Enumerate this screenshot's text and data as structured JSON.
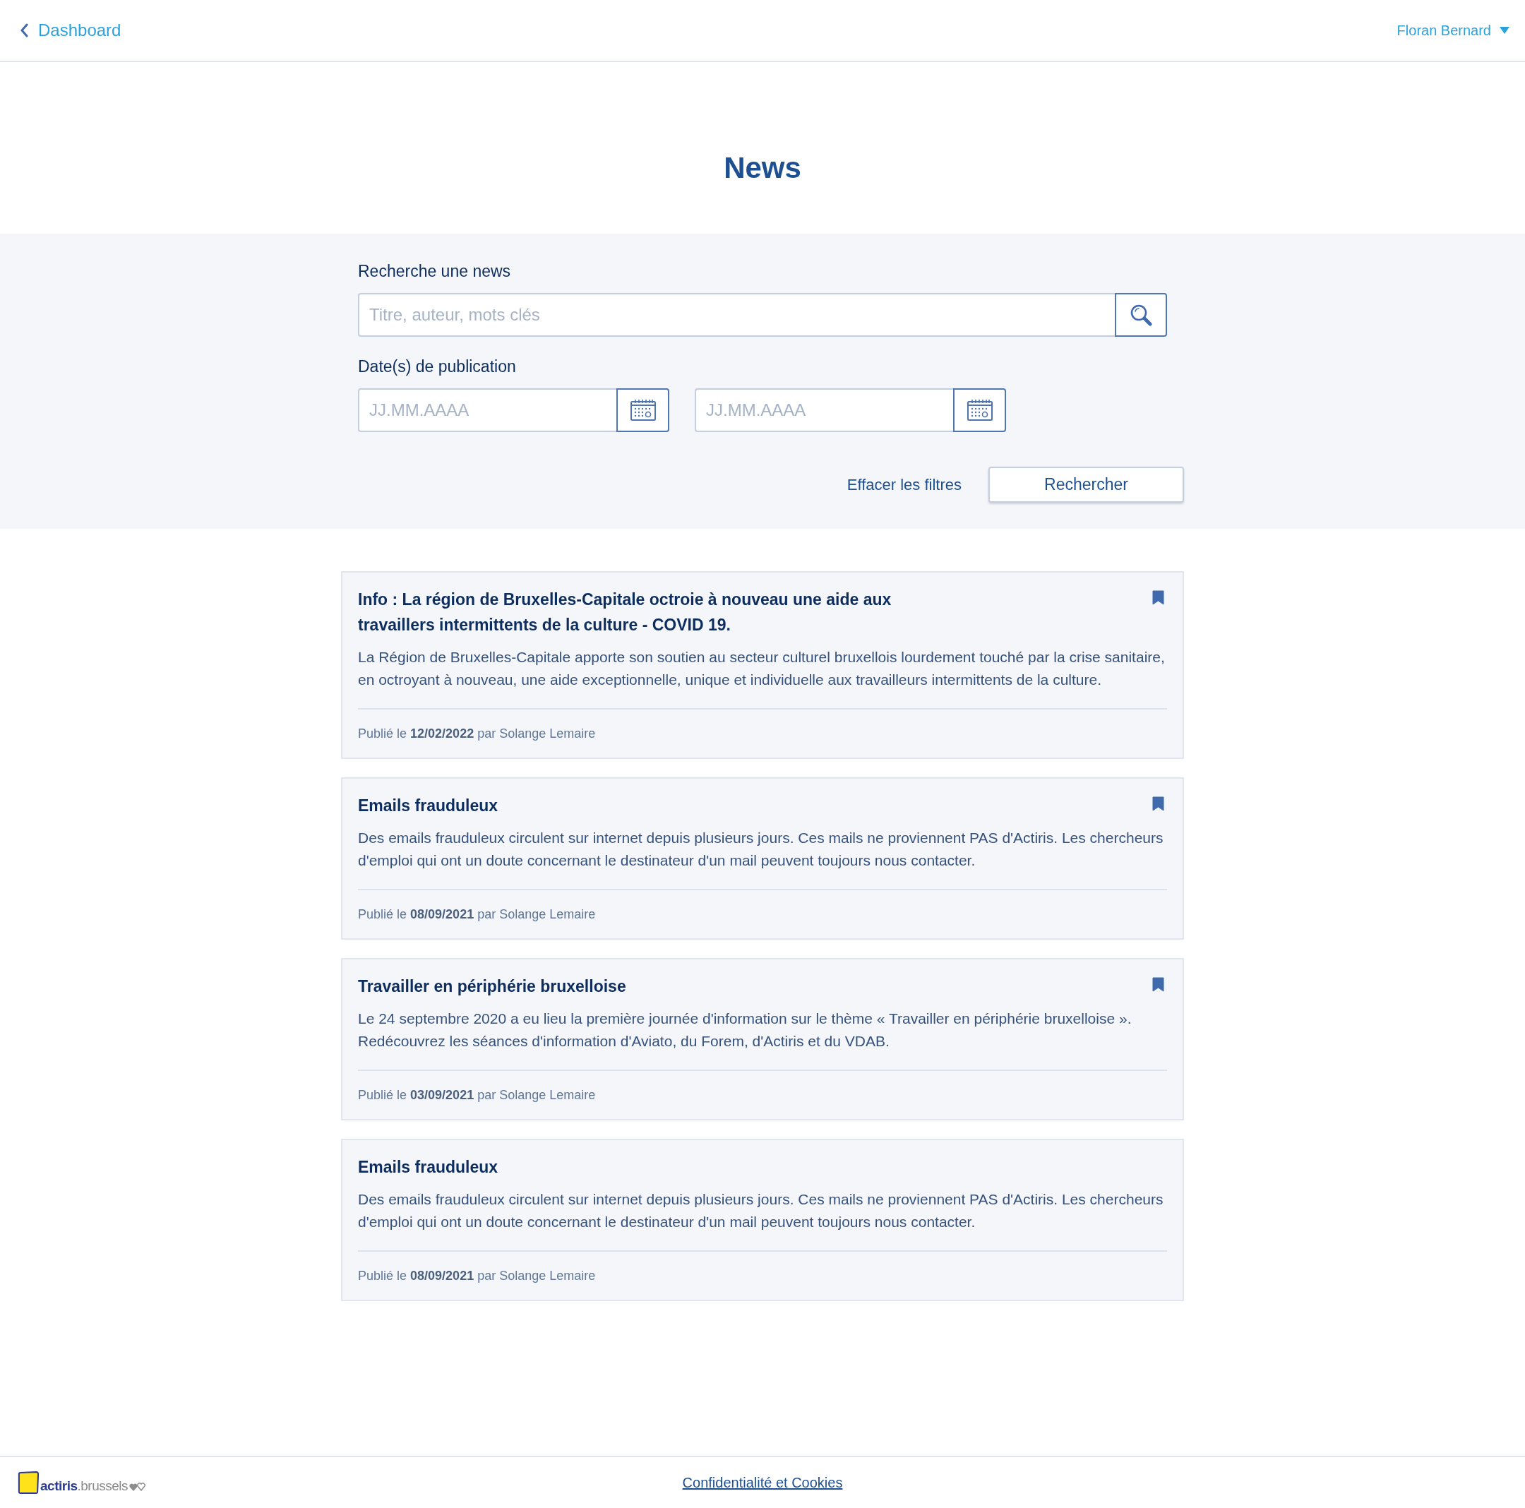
{
  "header": {
    "back_link": "Dashboard",
    "user_menu": "Floran Bernard"
  },
  "page_title": "News",
  "filters": {
    "search_label": "Recherche une news",
    "search": {
      "placeholder": "Titre, auteur, mots clés"
    },
    "date_label": "Date(s) de publication",
    "date_fields": [
      {
        "placeholder": "JJ.MM.AAAA"
      },
      {
        "placeholder": "JJ.MM.AAAA"
      }
    ],
    "clear_link": "Effacer les filtres",
    "submit_button": "Rechercher"
  },
  "news": [
    {
      "title": "Info : La région de Bruxelles-Capitale octroie à nouveau une aide aux travaillers intermittents de la culture - COVID 19.",
      "summary": "La Région de Bruxelles-Capitale apporte son soutien au secteur culturel bruxellois lourdement touché par la crise sanitaire, en octroyant à nouveau, une aide exceptionnelle, unique et individuelle aux travailleurs intermittents de la culture.",
      "published": "Publié le **12/02/2022** par Solange Lemaire",
      "bookmarked": true
    },
    {
      "title": "Emails frauduleux",
      "summary": "Des emails frauduleux circulent sur internet depuis plusieurs jours. Ces mails ne proviennent PAS d'Actiris. Les chercheurs d'emploi qui ont un doute concernant le destinateur d'un mail peuvent toujours nous contacter.",
      "published": "Publié le **08/09/2021** par Solange Lemaire",
      "bookmarked": true
    },
    {
      "title": "Travailler en périphérie bruxelloise",
      "summary": "Le 24 septembre 2020 a eu lieu la première journée d'information sur le thème « Travailler en périphérie bruxelloise ». Redécouvrez les séances d'information d'Aviato, du Forem, d'Actiris et du VDAB.",
      "published": "Publié le **03/09/2021** par Solange Lemaire",
      "bookmarked": true
    },
    {
      "title": "Emails frauduleux",
      "summary": "Des emails frauduleux circulent sur internet depuis plusieurs jours. Ces mails ne proviennent PAS d'Actiris. Les chercheurs d'emploi qui ont un doute concernant le destinateur d'un mail peuvent toujours nous contacter.",
      "published": "Publié le **08/09/2021** par Solange Lemaire",
      "bookmarked": false
    }
  ],
  "footer": {
    "logo": "**actiris**.brussels",
    "link": "Confidentialité et Cookies"
  }
}
